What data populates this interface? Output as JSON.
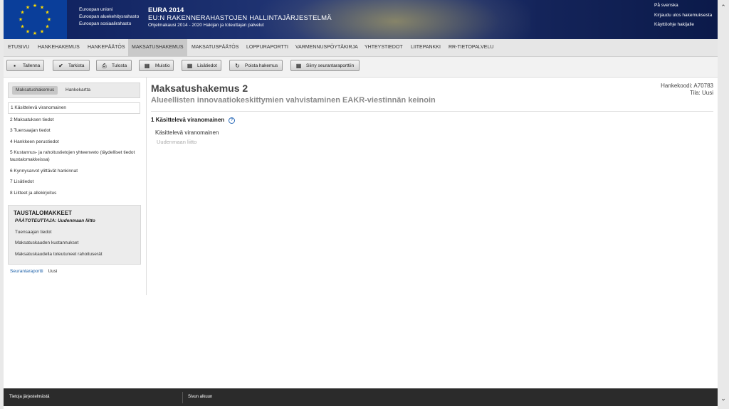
{
  "header": {
    "funds": [
      "Euroopan unioni",
      "Euroopan aluekehitysrahasto",
      "Euroopan sosiaalirahasto"
    ],
    "app_title": "EURA 2014",
    "app_subtitle": "EU:N RAKENNERAHASTOJEN HALLINTAJÄRJESTELMÄ",
    "app_tagline": "Ohjelmakausi 2014 - 2020 Hakijan ja toteuttajan palvelut",
    "links": {
      "swedish": "På svenska",
      "logout": "Kirjaudu ulos hakemuksesta",
      "guide": "Käyttöohje hakijalle"
    }
  },
  "nav": {
    "items": [
      "ETUSIVU",
      "HANKEHAKEMUS",
      "HANKEPÄÄTÖS",
      "MAKSATUSHAKEMUS",
      "MAKSATUSPÄÄTÖS",
      "LOPPURAPORTTI",
      "VARMENNUSPÖYTÄKIRJA",
      "YHTEYSTIEDOT",
      "LIITEPANKKI",
      "RR-TIETOPALVELU"
    ],
    "active": "MAKSATUSHAKEMUS"
  },
  "toolbar": {
    "save": "Tallenna",
    "check": "Tarkista",
    "print": "Tulosta",
    "memo": "Muistio",
    "extra_info": "Lisätiedot",
    "delete": "Poista hakemus",
    "to_report": "Siirry seurantaraporttiin"
  },
  "sidebar": {
    "tabs": [
      "Maksatushakemus",
      "Hankekartta"
    ],
    "steps": [
      "1 Käsittelevä viranomainen",
      "2 Maksatuksen tiedot",
      "3 Tuensaajan tiedot",
      "4 Hankkeen perustiedot",
      "5 Kustannus- ja rahoitustietojen yhteenveto (täydelliset tiedot taustalomakkeissa)",
      "6 Kynnysarvot ylittävät hankinnat",
      "7 Lisätiedot",
      "8 Liitteet ja allekirjoitus"
    ],
    "background_forms": {
      "title": "TAUSTALOMAKKEET",
      "implementer": "PÄÄTOTEUTTAJA: Uudenmaan liitto",
      "links": [
        "Tuensaajan tiedot",
        "Maksatuskauden kustannukset",
        "Maksatuskaudella toteutuneet rahoituserät"
      ]
    },
    "report_link": "Seurantaraportti",
    "report_status": "Uusi"
  },
  "main": {
    "title": "Maksatushakemus 2",
    "subtitle": "Alueellisten innovaatiokeskittymien vahvistaminen EAKR-viestinnän keinoin",
    "project_code": "Hankekoodi: A70783",
    "status": "Tila: Uusi",
    "section_title": "1 Käsittelevä viranomainen",
    "field_label": "Käsittelevä viranomainen",
    "field_value": "Uudenmaan liitto"
  },
  "footer": {
    "about": "Tietoja järjestelmästä",
    "top": "Sivun alkuun"
  },
  "colors": {
    "header_bg": "#0d1f5c",
    "nav_active": "#c9c9c9",
    "footer_bg": "#2b2b2b",
    "link": "#1a5fa8"
  }
}
